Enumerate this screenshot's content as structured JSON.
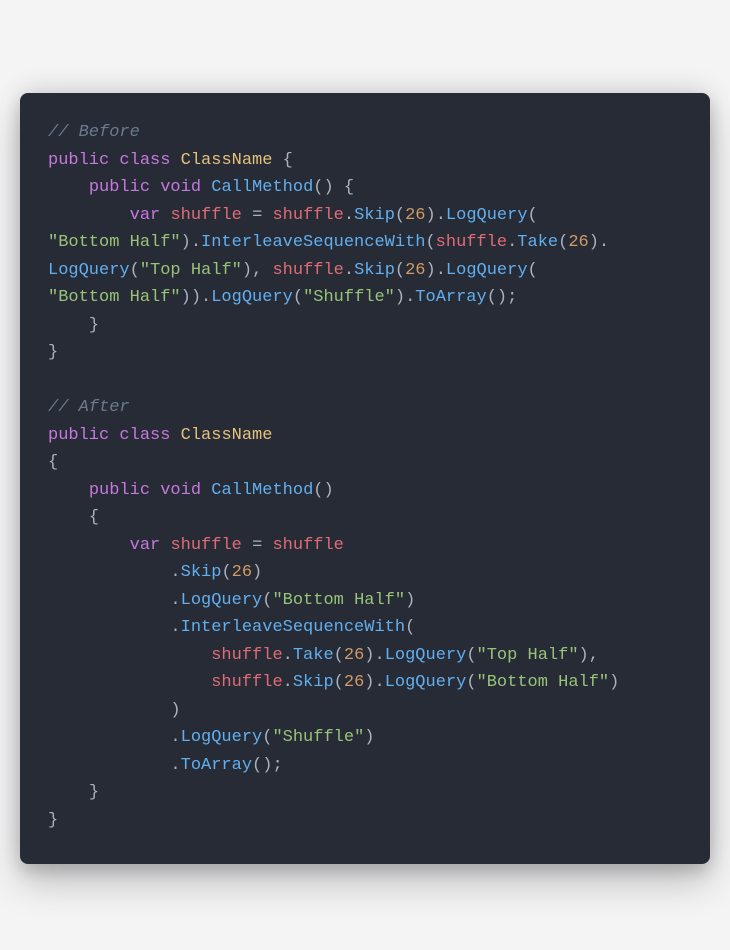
{
  "code": {
    "comment_before": "// Before",
    "comment_after": "// After",
    "kw_public": "public",
    "kw_class": "class",
    "kw_void": "void",
    "kw_var": "var",
    "type_ClassName": "ClassName",
    "fn_CallMethod": "CallMethod",
    "var_shuffle": "shuffle",
    "fn_Skip": "Skip",
    "fn_Take": "Take",
    "fn_LogQuery": "LogQuery",
    "fn_InterleaveSequenceWith": "InterleaveSequenceWith",
    "fn_ToArray": "ToArray",
    "num_26": "26",
    "str_bottom_half": "\"Bottom Half\"",
    "str_top_half": "\"Top Half\"",
    "str_shuffle": "\"Shuffle\"",
    "eq": "=",
    "dot": ".",
    "comma": ",",
    "comma_sp": ", ",
    "lparen": "(",
    "rparen": ")",
    "lbrace": "{",
    "rbrace": "}",
    "semi": ";",
    "empty_parens": "()",
    "rparen_dot": ").",
    "rparen_rparen_dot": ")).",
    "rparen_semi": ");",
    "empty_parens_semi": "();",
    "lparen_rparen_sp_lbrace": "() {",
    "sp_lbrace": " {"
  }
}
